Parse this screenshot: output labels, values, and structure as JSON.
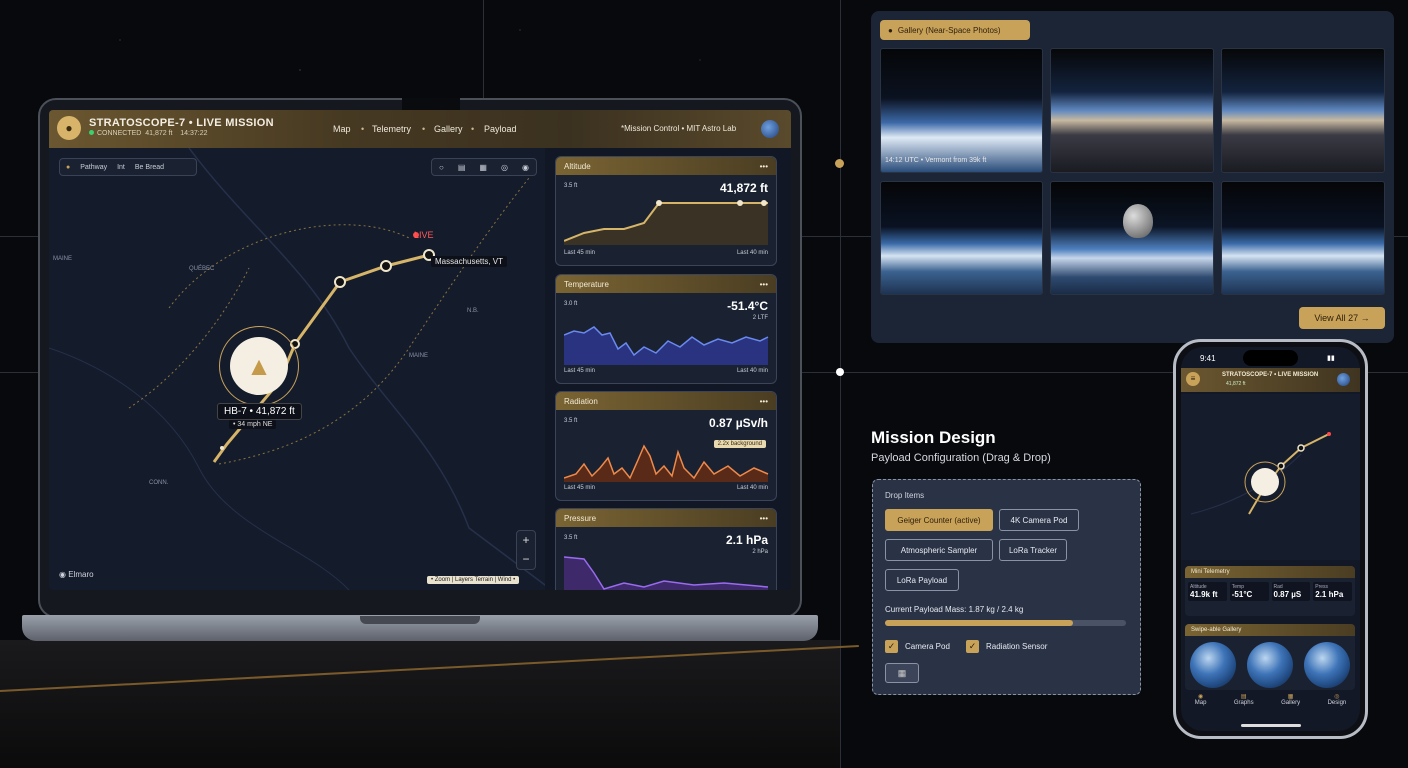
{
  "laptop": {
    "title": "STRATOSCOPE-7 • LIVE MISSION",
    "status": "CONNECTED",
    "status_alt": "41,872 ft",
    "status_time": "14:37:22",
    "nav": [
      "Map",
      "Telemetry",
      "Gallery",
      "Payload"
    ],
    "org": "*Mission Control • MIT Astro Lab",
    "breadcrumb": [
      "Pathway",
      "Int",
      "Be Bread"
    ],
    "live_label": "LIVE",
    "location_label": "Massachusetts, VT",
    "balloon_label": "HB-7 • 41,872 ft",
    "speed_label": "• 34 mph NE",
    "map_logo": "Elmaro",
    "map_legend": "• Zoom | Layers Terrain | Wind •",
    "panels": [
      {
        "title": "Altitude",
        "value": "41,872 ft",
        "left": "3.5 ft",
        "sub": "",
        "foot_left": "Last 45 min",
        "foot_right": "Last 40 min",
        "color": "#c9a25a"
      },
      {
        "title": "Temperature",
        "value": "-51.4°C",
        "left": "3.0 ft",
        "sub": "2 LTF",
        "foot_left": "Last 45 min",
        "foot_right": "Last 40 min",
        "color": "#4a6fe0"
      },
      {
        "title": "Radiation",
        "value": "0.87 µSv/h",
        "left": "3.5 ft",
        "sub": "",
        "note": "2.2x background",
        "foot_left": "Last 45 min",
        "foot_right": "Last 40 min",
        "color": "#e07a3a"
      },
      {
        "title": "Pressure",
        "value": "2.1 hPa",
        "left": "3.5 ft",
        "sub": "2 hPa",
        "foot_left": "",
        "foot_right": "",
        "color": "#8a4ee0"
      }
    ]
  },
  "gallery": {
    "button": "Gallery (Near-Space Photos)",
    "caption": "14:12 UTC • Vermont from 39k ft",
    "view_all": "View All 27 →"
  },
  "mission": {
    "title": "Mission Design",
    "subtitle": "Payload Configuration (Drag & Drop)",
    "drop_label": "Drop Items",
    "chips": [
      "Geiger Counter (active)",
      "4K Camera Pod",
      "Atmospheric Sampler",
      "LoRa Tracker",
      "LoRa Payload"
    ],
    "mass_label": "Current Payload Mass: 1.87 kg / 2.4 kg",
    "mass_fraction": 0.78,
    "checks": [
      "Camera Pod",
      "Radiation Sensor"
    ]
  },
  "phone": {
    "time": "9:41",
    "title": "STRATOSCOPE-7 • LIVE MISSION",
    "substat": "41,872 ft",
    "telemetry_title": "Mini Telemetry",
    "tiles": [
      {
        "label": "Altitude",
        "value": "41.9k ft"
      },
      {
        "label": "Temp",
        "value": "-51°C"
      },
      {
        "label": "Rad",
        "value": "0.87 µS"
      },
      {
        "label": "Press",
        "value": "2.1 hPa"
      }
    ],
    "gallery_title": "Swipe-able Gallery",
    "tabs": [
      "Map",
      "Graphs",
      "Gallery",
      "Design"
    ]
  },
  "colors": {
    "accent": "#c9a25a",
    "panel": "#1a2232",
    "bg": "#07090d"
  }
}
